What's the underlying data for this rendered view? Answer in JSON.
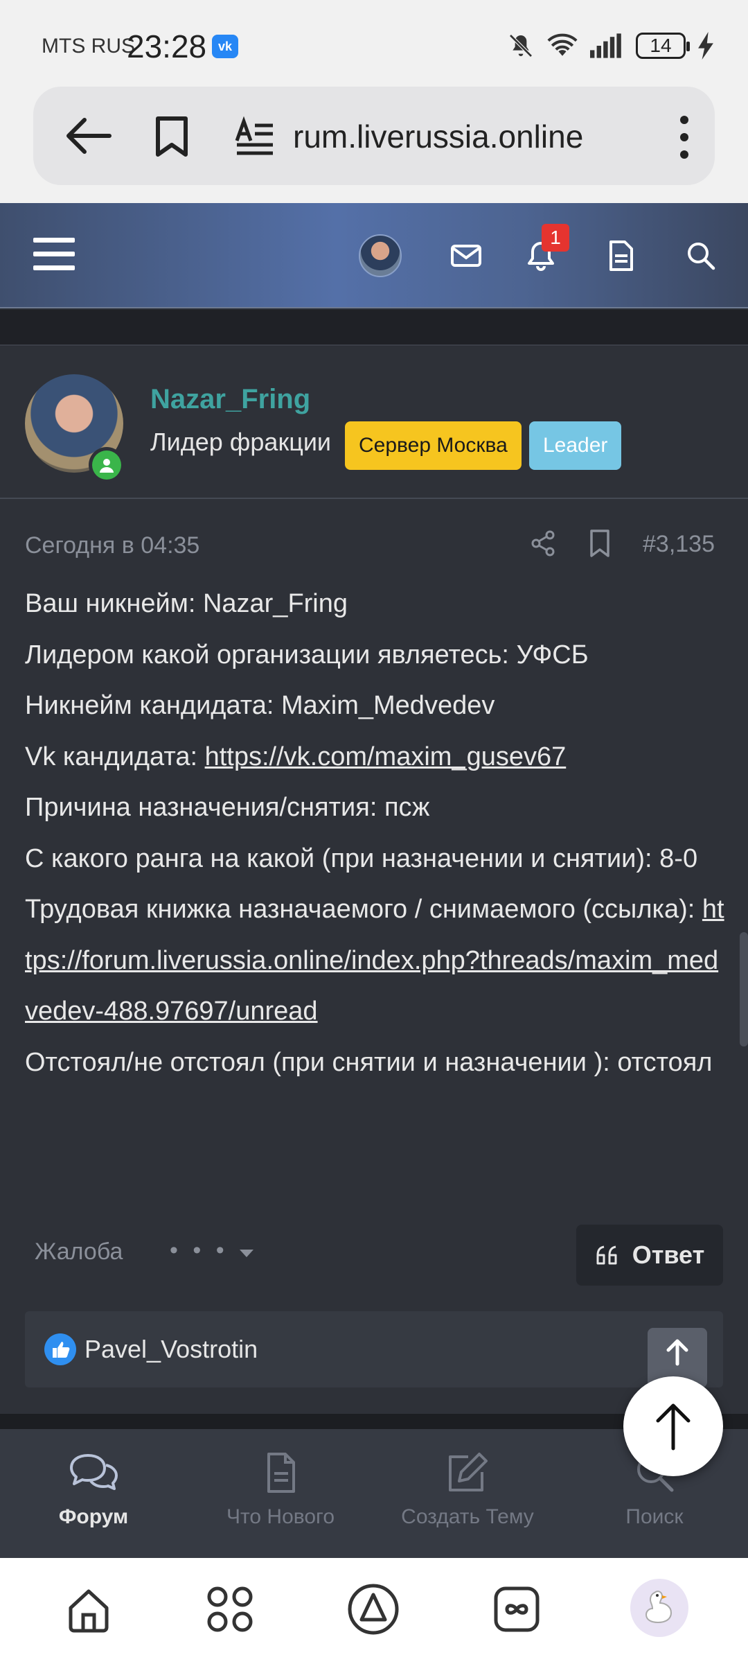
{
  "status_bar": {
    "carrier": "MTS RUS",
    "time": "23:28",
    "vk_badge": "vk",
    "battery": "14"
  },
  "browser": {
    "url": "rum.liverussia.online"
  },
  "forum_header": {
    "notification_count": "1"
  },
  "post": {
    "author": "Nazar_Fring",
    "user_title": "Лидер фракции",
    "badges": [
      "Сервер Москва",
      "Leader"
    ],
    "date": "Сегодня в 04:35",
    "number": "#3,135",
    "lines": [
      "Ваш никнейм: Nazar_Fring",
      "Лидером какой организации являетесь: УФСБ",
      "Никнейм кандидата: Maxim_Medvedev",
      "Vk кандидата: ",
      "Причина назначения/снятия: псж",
      "С какого ранга на какой (при назначении и снятии): 8-0",
      "Трудовая книжка назначаемого / снимаемого (ссылка): ",
      "Отстоял/не отстоял (при снятии и назначении ): отстоял"
    ],
    "vk_link": "https://vk.com/maxim_gusev67",
    "workbook_link": "https://forum.liverussia.online/index.php?threads/maxim_medvedev-488.97697/unread",
    "report_label": "Жалоба",
    "more_label": "• • •",
    "reply_label": "Ответ",
    "liked_by": "Pavel_Vostrotin"
  },
  "tabbar": {
    "items": [
      {
        "label": "Форум",
        "icon": "chat-bubbles-icon",
        "active": true
      },
      {
        "label": "Что Нового",
        "icon": "document-icon",
        "active": false
      },
      {
        "label": "Создать Тему",
        "icon": "edit-icon",
        "active": false
      },
      {
        "label": "Поиск",
        "icon": "search-icon",
        "active": false
      }
    ]
  },
  "colors": {
    "username": "#3fa3a0",
    "server_badge": "#f6c51f",
    "leader_badge": "#76c6e4",
    "notification": "#e5342f"
  }
}
